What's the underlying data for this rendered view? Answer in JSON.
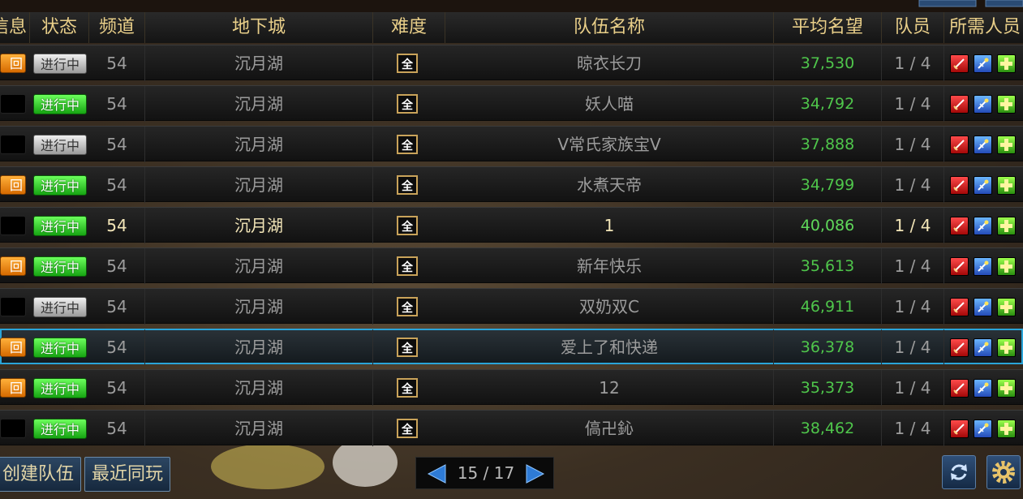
{
  "header": {
    "cols": [
      "信息",
      "状态",
      "频道",
      "地下城",
      "难度",
      "队伍名称",
      "平均名望",
      "队员",
      "所需人员"
    ]
  },
  "rows": [
    {
      "back": "回",
      "status": "进行中",
      "status_style": "gray",
      "channel": "54",
      "dungeon": "沉月湖",
      "difficulty": "全",
      "team": "晾衣长刀",
      "rep": "37,530",
      "members": "1 / 4"
    },
    {
      "back": "",
      "status": "进行中",
      "status_style": "green",
      "channel": "54",
      "dungeon": "沉月湖",
      "difficulty": "全",
      "team": "妖人喵",
      "rep": "34,792",
      "members": "1 / 4"
    },
    {
      "back": "",
      "status": "进行中",
      "status_style": "gray",
      "channel": "54",
      "dungeon": "沉月湖",
      "difficulty": "全",
      "team": "V常氏家族宝V",
      "rep": "37,888",
      "members": "1 / 4"
    },
    {
      "back": "回",
      "status": "进行中",
      "status_style": "green",
      "channel": "54",
      "dungeon": "沉月湖",
      "difficulty": "全",
      "team": "水煮天帝",
      "rep": "34,799",
      "members": "1 / 4"
    },
    {
      "back": "",
      "status": "进行中",
      "status_style": "green",
      "channel": "54",
      "dungeon": "沉月湖",
      "difficulty": "全",
      "team": "1",
      "rep": "40,086",
      "members": "1 / 4"
    },
    {
      "back": "回",
      "status": "进行中",
      "status_style": "green",
      "channel": "54",
      "dungeon": "沉月湖",
      "difficulty": "全",
      "team": "新年快乐",
      "rep": "35,613",
      "members": "1 / 4"
    },
    {
      "back": "",
      "status": "进行中",
      "status_style": "gray",
      "channel": "54",
      "dungeon": "沉月湖",
      "difficulty": "全",
      "team": "双奶双C",
      "rep": "46,911",
      "members": "1 / 4"
    },
    {
      "back": "回",
      "status": "进行中",
      "status_style": "green",
      "channel": "54",
      "dungeon": "沉月湖",
      "difficulty": "全",
      "team": "爱上了和快递",
      "rep": "36,378",
      "members": "1 / 4"
    },
    {
      "back": "回",
      "status": "进行中",
      "status_style": "green",
      "channel": "54",
      "dungeon": "沉月湖",
      "difficulty": "全",
      "team": "12",
      "rep": "35,373",
      "members": "1 / 4"
    },
    {
      "back": "",
      "status": "进行中",
      "status_style": "green",
      "channel": "54",
      "dungeon": "沉月湖",
      "difficulty": "全",
      "team": "傐卍鈊",
      "rep": "38,462",
      "members": "1 / 4"
    }
  ],
  "footer": {
    "create_team": "创建队伍",
    "recent_play": "最近同玩",
    "page": "15 / 17"
  },
  "colors": {
    "header_text": "#e9cf89",
    "reputation": "#4fc64b",
    "selected_border": "#2aa4d8"
  },
  "icons": [
    "prev-page-icon",
    "next-page-icon",
    "refresh-icon",
    "settings-gear-icon",
    "sword-icon",
    "staff-icon",
    "plus-icon"
  ]
}
